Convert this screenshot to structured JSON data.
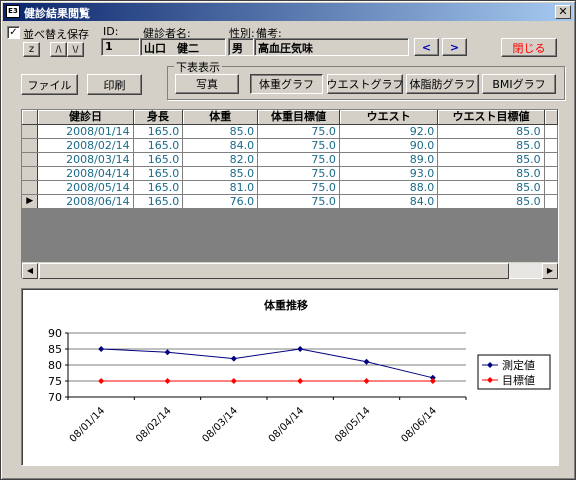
{
  "window": {
    "title": "健診結果閲覧",
    "icon": "form-icon",
    "close_glyph": "✕"
  },
  "toolbar": {
    "sort_save_label": "並べ替え保存",
    "sort_save_checked": true,
    "check_glyph": "✓",
    "sort_z_label": "z",
    "sort_asc_label": "/\\",
    "sort_desc_label": "\\/",
    "file_label": "ファイル",
    "print_label": "印刷",
    "close_label": "閉じる"
  },
  "patient": {
    "id_label": "ID:",
    "id_value": "1",
    "name_label": "健診者名:",
    "name_value": "山口　健二",
    "sex_label": "性別:",
    "sex_value": "男",
    "note_label": "備考:",
    "note_value": "高血圧気味",
    "prev_label": "<",
    "next_label": ">"
  },
  "view_group": {
    "title": "下表表示",
    "buttons": [
      "写真",
      "体重グラフ",
      "ウエストグラフ",
      "体脂肪グラフ",
      "BMIグラフ"
    ],
    "active": "体重グラフ"
  },
  "table": {
    "columns": [
      "健診日",
      "身長",
      "体重",
      "体重目標値",
      "ウエスト",
      "ウエスト目標値"
    ],
    "current_row_glyph": "▶",
    "rows": [
      [
        "2008/01/14",
        "165.0",
        "85.0",
        "75.0",
        "92.0",
        "85.0"
      ],
      [
        "2008/02/14",
        "165.0",
        "84.0",
        "75.0",
        "90.0",
        "85.0"
      ],
      [
        "2008/03/14",
        "165.0",
        "82.0",
        "75.0",
        "89.0",
        "85.0"
      ],
      [
        "2008/04/14",
        "165.0",
        "85.0",
        "75.0",
        "93.0",
        "85.0"
      ],
      [
        "2008/05/14",
        "165.0",
        "81.0",
        "75.0",
        "88.0",
        "85.0"
      ],
      [
        "2008/06/14",
        "165.0",
        "76.0",
        "75.0",
        "84.0",
        "85.0"
      ]
    ],
    "current_row": 5,
    "scroll_left_glyph": "◀",
    "scroll_right_glyph": "▶"
  },
  "colors": {
    "cell_text": "#1a6b8a",
    "series_measured": "#000080",
    "series_target": "#ff0000",
    "title_bar_start": "#0a246a",
    "close_label_color": "#ff0000"
  },
  "chart_data": {
    "type": "line",
    "title": "体重推移",
    "categories": [
      "08/01/14",
      "08/02/14",
      "08/03/14",
      "08/04/14",
      "08/05/14",
      "08/06/14"
    ],
    "series": [
      {
        "name": "測定値",
        "values": [
          85,
          84,
          82,
          85,
          81,
          76
        ],
        "color": "#000080",
        "marker": "diamond"
      },
      {
        "name": "目標値",
        "values": [
          75,
          75,
          75,
          75,
          75,
          75
        ],
        "color": "#ff0000",
        "marker": "diamond"
      }
    ],
    "ylim": [
      70,
      90
    ],
    "yticks": [
      70,
      75,
      80,
      85,
      90
    ],
    "xlabel": "",
    "ylabel": "",
    "grid": true,
    "legend_position": "right"
  }
}
